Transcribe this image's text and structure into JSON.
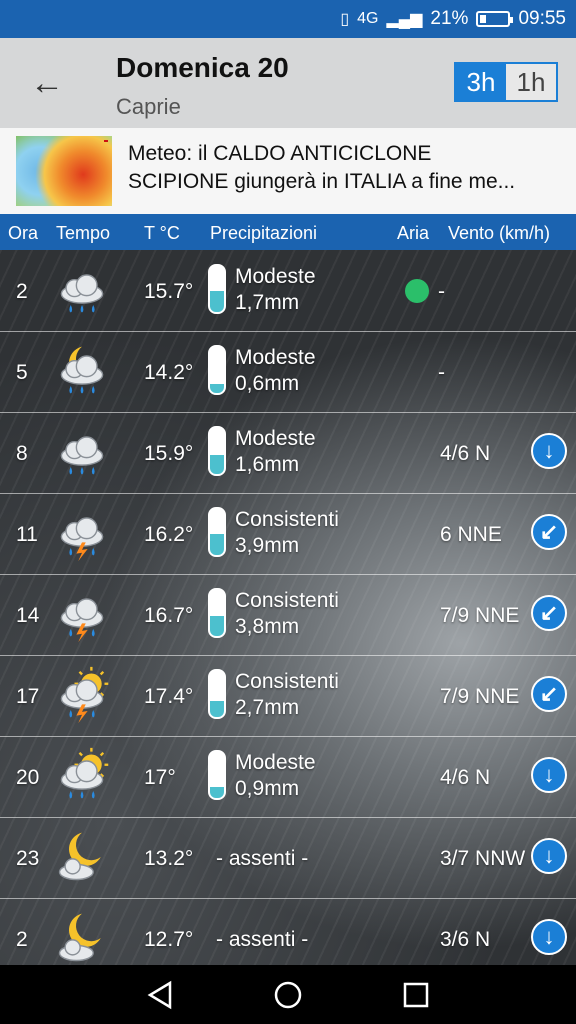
{
  "status": {
    "network": "4G",
    "battery": "21%",
    "time": "09:55"
  },
  "header": {
    "title": "Domenica 20",
    "location": "Caprie",
    "toggle_3h": "3h",
    "toggle_1h": "1h"
  },
  "news": {
    "line1": "Meteo: il CALDO ANTICICLONE",
    "line2": "SCIPIONE giungerà in ITALIA a fine me..."
  },
  "columns": {
    "ora": "Ora",
    "tempo": "Tempo",
    "temp": "T °C",
    "precip": "Precipitazioni",
    "aria": "Aria",
    "vento": "Vento (km/h)"
  },
  "rows": [
    {
      "hour": "2",
      "icon": "rain-cloud-icon",
      "temp": "15.7°",
      "precip_label": "Modeste",
      "precip_amount": "1,7mm",
      "precip_level": 0.45,
      "aria": "green",
      "wind": "-",
      "wind_arrow": null
    },
    {
      "hour": "5",
      "icon": "moon-rain-cloud-icon",
      "temp": "14.2°",
      "precip_label": "Modeste",
      "precip_amount": "0,6mm",
      "precip_level": 0.2,
      "aria": null,
      "wind": "-",
      "wind_arrow": null
    },
    {
      "hour": "8",
      "icon": "rain-cloud-icon",
      "temp": "15.9°",
      "precip_label": "Modeste",
      "precip_amount": "1,6mm",
      "precip_level": 0.42,
      "aria": null,
      "wind": "4/6 N",
      "wind_arrow": "↓"
    },
    {
      "hour": "11",
      "icon": "thunder-cloud-icon",
      "temp": "16.2°",
      "precip_label": "Consistenti",
      "precip_amount": "3,9mm",
      "precip_level": 0.45,
      "aria": null,
      "wind": "6 NNE",
      "wind_arrow": "↙"
    },
    {
      "hour": "14",
      "icon": "thunder-cloud-icon",
      "temp": "16.7°",
      "precip_label": "Consistenti",
      "precip_amount": "3,8mm",
      "precip_level": 0.43,
      "aria": null,
      "wind": "7/9 NNE",
      "wind_arrow": "↙"
    },
    {
      "hour": "17",
      "icon": "sun-thunder-cloud-icon",
      "temp": "17.4°",
      "precip_label": "Consistenti",
      "precip_amount": "2,7mm",
      "precip_level": 0.35,
      "aria": null,
      "wind": "7/9 NNE",
      "wind_arrow": "↙"
    },
    {
      "hour": "20",
      "icon": "sun-rain-cloud-icon",
      "temp": "17°",
      "precip_label": "Modeste",
      "precip_amount": "0,9mm",
      "precip_level": 0.25,
      "aria": null,
      "wind": "4/6 N",
      "wind_arrow": "↓"
    },
    {
      "hour": "23",
      "icon": "moon-cloud-icon",
      "temp": "13.2°",
      "precip_label": "- assenti -",
      "precip_amount": null,
      "precip_level": 0,
      "aria": null,
      "wind": "3/7 NNW",
      "wind_arrow": "↓"
    },
    {
      "hour": "2",
      "icon": "moon-cloud-icon",
      "temp": "12.7°",
      "precip_label": "- assenti -",
      "precip_amount": null,
      "precip_level": 0,
      "aria": null,
      "wind": "3/6 N",
      "wind_arrow": "↓"
    }
  ],
  "colors": {
    "primary": "#1b63b0",
    "accent": "#1b7fd6",
    "aria_good": "#2bbf6a",
    "precip_fill": "#4cc0ce"
  }
}
